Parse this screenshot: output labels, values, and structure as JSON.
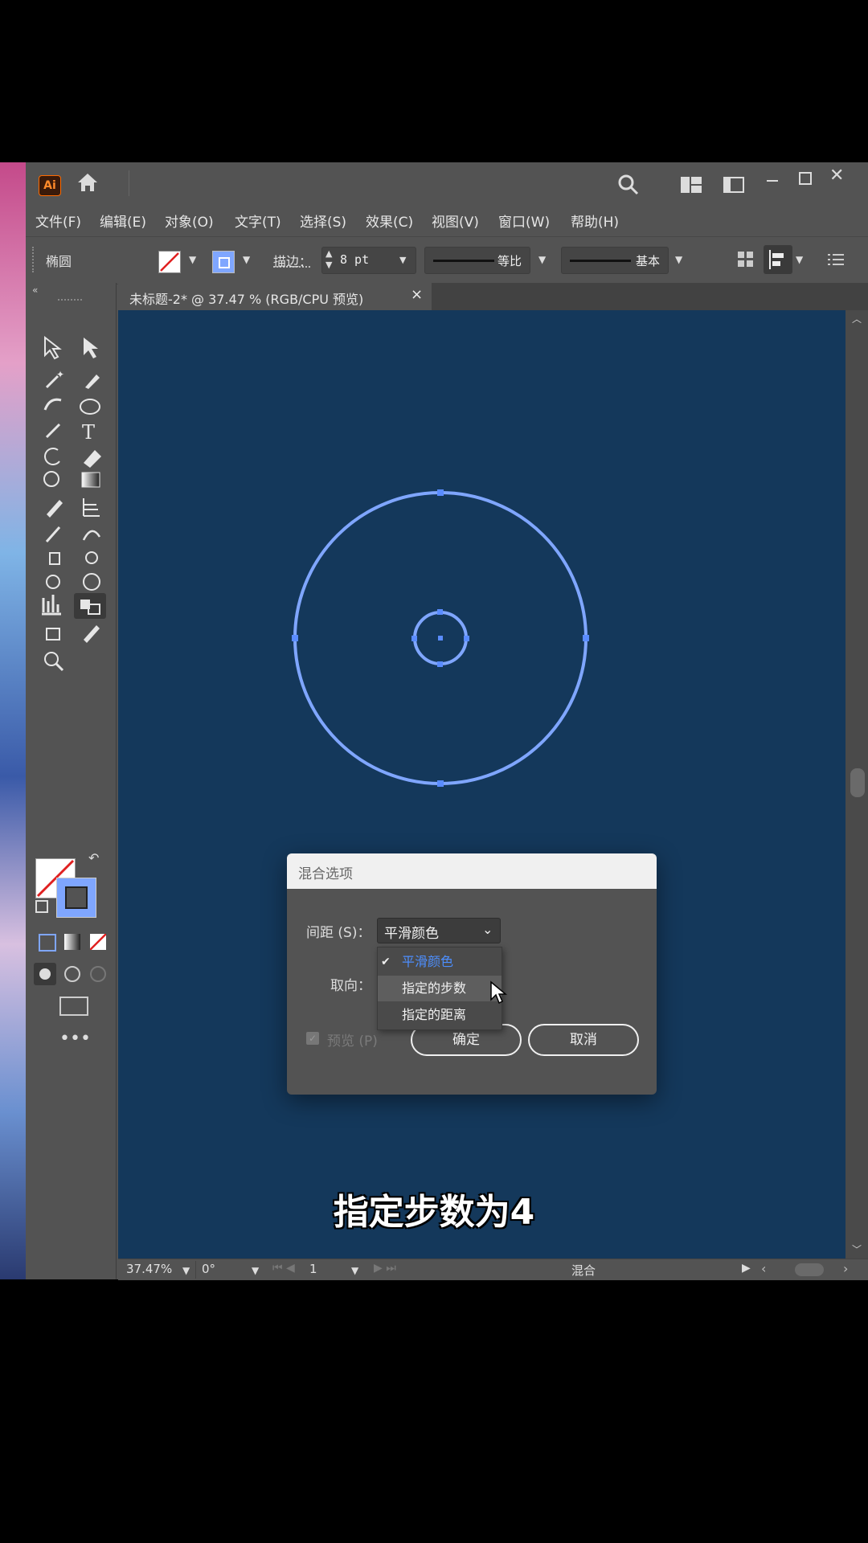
{
  "app": {
    "logo": "Ai",
    "menu": [
      "文件(F)",
      "编辑(E)",
      "对象(O)",
      "文字(T)",
      "选择(S)",
      "效果(C)",
      "视图(V)",
      "窗口(W)",
      "帮助(H)"
    ],
    "icons": {
      "home": "home-icon",
      "search": "search-icon",
      "workspace": "workspace-icon",
      "panel": "panel-icon"
    }
  },
  "controlbar": {
    "object_type": "椭圆",
    "stroke_label": "描边：",
    "stroke_value": "8 pt",
    "profile_label": "等比",
    "brush_label": "基本"
  },
  "document": {
    "tab_title": "未标题-2* @ 37.47 % (RGB/CPU 预览)",
    "tab_close": "×"
  },
  "status": {
    "zoom": "37.47%",
    "rotation": "0°",
    "artboard": "1",
    "tool_name": "混合"
  },
  "dialog": {
    "title": "混合选项",
    "spacing_label": "间距 (S)：",
    "spacing_value": "平滑颜色",
    "orientation_label": "取向：",
    "options": [
      "平滑颜色",
      "指定的步数",
      "指定的距离"
    ],
    "selected_option": "平滑颜色",
    "hovered_option": "指定的步数",
    "preview_label": "预览 (P)",
    "ok_label": "确定",
    "cancel_label": "取消"
  },
  "caption": "指定步数为4",
  "colors": {
    "canvas_bg": "#14385b",
    "ui_bg": "#535353",
    "circle_stroke": "#7fa6ff",
    "highlight": "#4d8fff"
  }
}
